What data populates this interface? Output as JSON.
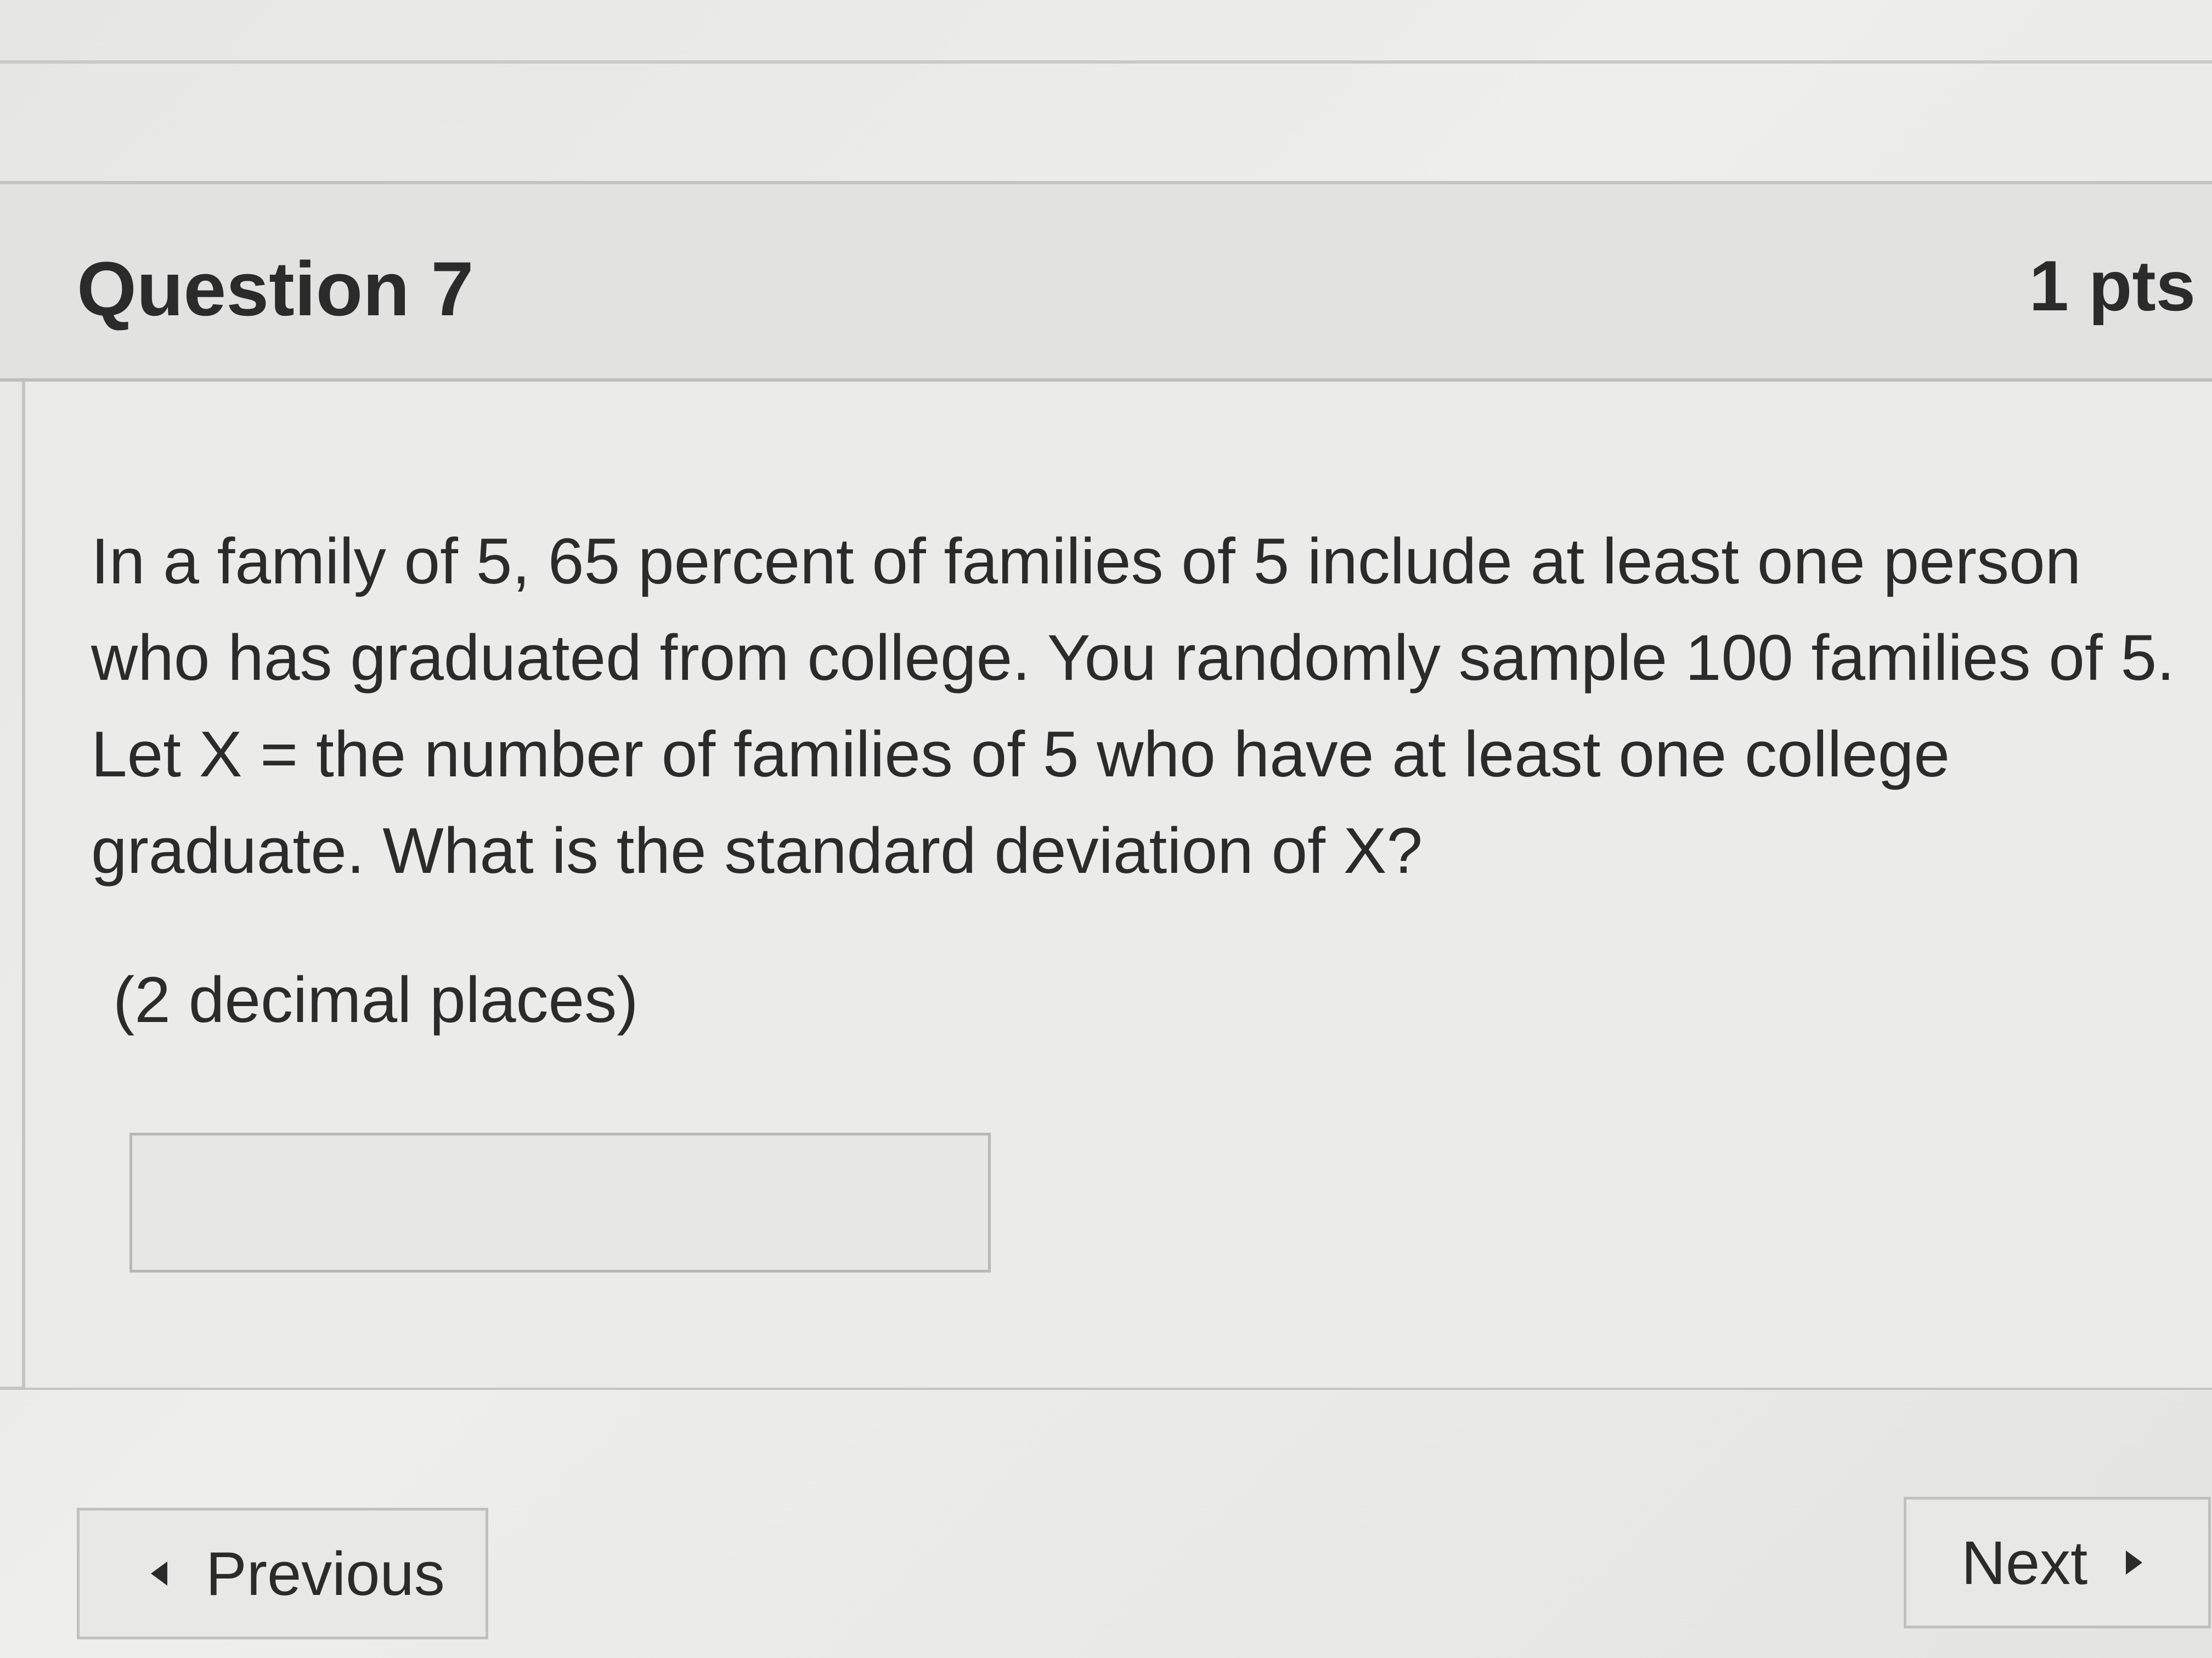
{
  "question": {
    "title": "Question 7",
    "points": "1 pts",
    "text": "In a family of 5, 65 percent of families of 5 include at least one person who has graduated from college. You randomly sample 100 families of 5. Let X = the number of families of 5 who have at least one college graduate. What is the standard deviation of X?",
    "hint": "(2 decimal places)"
  },
  "answer": {
    "value": "",
    "placeholder": ""
  },
  "navigation": {
    "previous_label": "Previous",
    "next_label": "Next",
    "previous_icon": "caret-left-icon",
    "next_icon": "caret-right-icon"
  }
}
